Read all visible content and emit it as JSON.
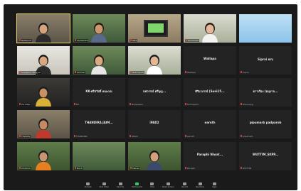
{
  "tiles": [
    {
      "type": "video",
      "bg": "bg-room",
      "label": "Nattawut",
      "active": true,
      "skin": "#d6a47c",
      "shirt": "#2b2b2b",
      "hair": "#1a1a1a"
    },
    {
      "type": "video",
      "bg": "bg-green",
      "label": "Saowanee",
      "skin": "#c99872",
      "shirt": "#5a6a8a",
      "hair": "#2a1a12"
    },
    {
      "type": "video",
      "bg": "bg-tv",
      "label": "iPad",
      "skin": null
    },
    {
      "type": "video",
      "bg": "bg-bright",
      "label": "Kanokwan",
      "skin": "#e2b99a",
      "shirt": "#f3f3f3",
      "hair": "#2a1a12"
    },
    {
      "type": "video",
      "bg": "bg-blue",
      "label": "",
      "skin": null
    },
    {
      "type": "video",
      "bg": "bg-wall",
      "label": "Supaporn Tongyai",
      "skin": "#d9a880",
      "shirt": "#2a2a2a",
      "hair": "#1a1a1a"
    },
    {
      "type": "video",
      "bg": "bg-green",
      "label": "Arunee",
      "skin": "#d7a985",
      "shirt": "#e6e6e6",
      "hair": "#2a1a12"
    },
    {
      "type": "video",
      "bg": "bg-bright",
      "label": "Ratchanee",
      "skin": "#e3b796",
      "shirt": "#ffffff",
      "hair": "#1a1a1a"
    },
    {
      "type": "name",
      "big": "Wallapa",
      "small": "Wallapa"
    },
    {
      "type": "name",
      "big": "Siprai ครบ",
      "small": "Siprai"
    },
    {
      "type": "video",
      "bg": "bg-dark",
      "label": "Pornthip",
      "skin": "#c99064",
      "shirt": "#d9b13a",
      "hair": "#1a1a1a"
    },
    {
      "type": "name",
      "big": "KK-ศรีสวัสดิ์ คณะมน",
      "small": "KK"
    },
    {
      "type": "name",
      "big": "นพวรรณ์ ศรีบุญ...",
      "small": "Noppawan"
    },
    {
      "type": "name",
      "big": "ศิริมาภรณ์ (Suni15...",
      "small": "Sirimaporn"
    },
    {
      "type": "name",
      "big": "ดาวเรือง (อนุบาล...",
      "small": "Daoruang"
    },
    {
      "type": "video",
      "bg": "bg-room",
      "label": "Thanida",
      "skin": "#c48a62",
      "shirt": "#c0392b",
      "hair": "#1a1a1a"
    },
    {
      "type": "name",
      "big": "THANDIRA JAIM...",
      "small": "THANDIRA"
    },
    {
      "type": "name",
      "big": "iPAD2",
      "small": "iPAD2"
    },
    {
      "type": "name",
      "big": "earnth",
      "small": "earnth"
    },
    {
      "type": "name",
      "big": "pipumarb padparob",
      "small": "pipumarb"
    },
    {
      "type": "video",
      "bg": "bg-garden",
      "label": "Chutima",
      "skin": "#c99470",
      "shirt": "#e67e22",
      "hair": "#1a1a1a"
    },
    {
      "type": "video",
      "bg": "bg-green",
      "label": "Nuch",
      "skin": null
    },
    {
      "type": "video",
      "bg": "bg-garden",
      "label": "Manee",
      "skin": "#d2a07c",
      "shirt": "#3c4a6a",
      "hair": "#1a1a1a"
    },
    {
      "type": "name",
      "big": "Paraphi Niwat...",
      "small": "Paraphi"
    },
    {
      "type": "name",
      "big": "WUTTIM_SKPP...",
      "small": "WUTTIM"
    }
  ],
  "toolbar": [
    {
      "label": "Unmute",
      "green": false
    },
    {
      "label": "Stop Video",
      "green": false
    },
    {
      "label": "Security",
      "green": false
    },
    {
      "label": "Participants",
      "green": true
    },
    {
      "label": "Chat",
      "green": false
    },
    {
      "label": "Share Screen",
      "green": false
    },
    {
      "label": "Record",
      "green": false
    },
    {
      "label": "Reactions",
      "green": false
    },
    {
      "label": "Apps",
      "green": false
    }
  ]
}
